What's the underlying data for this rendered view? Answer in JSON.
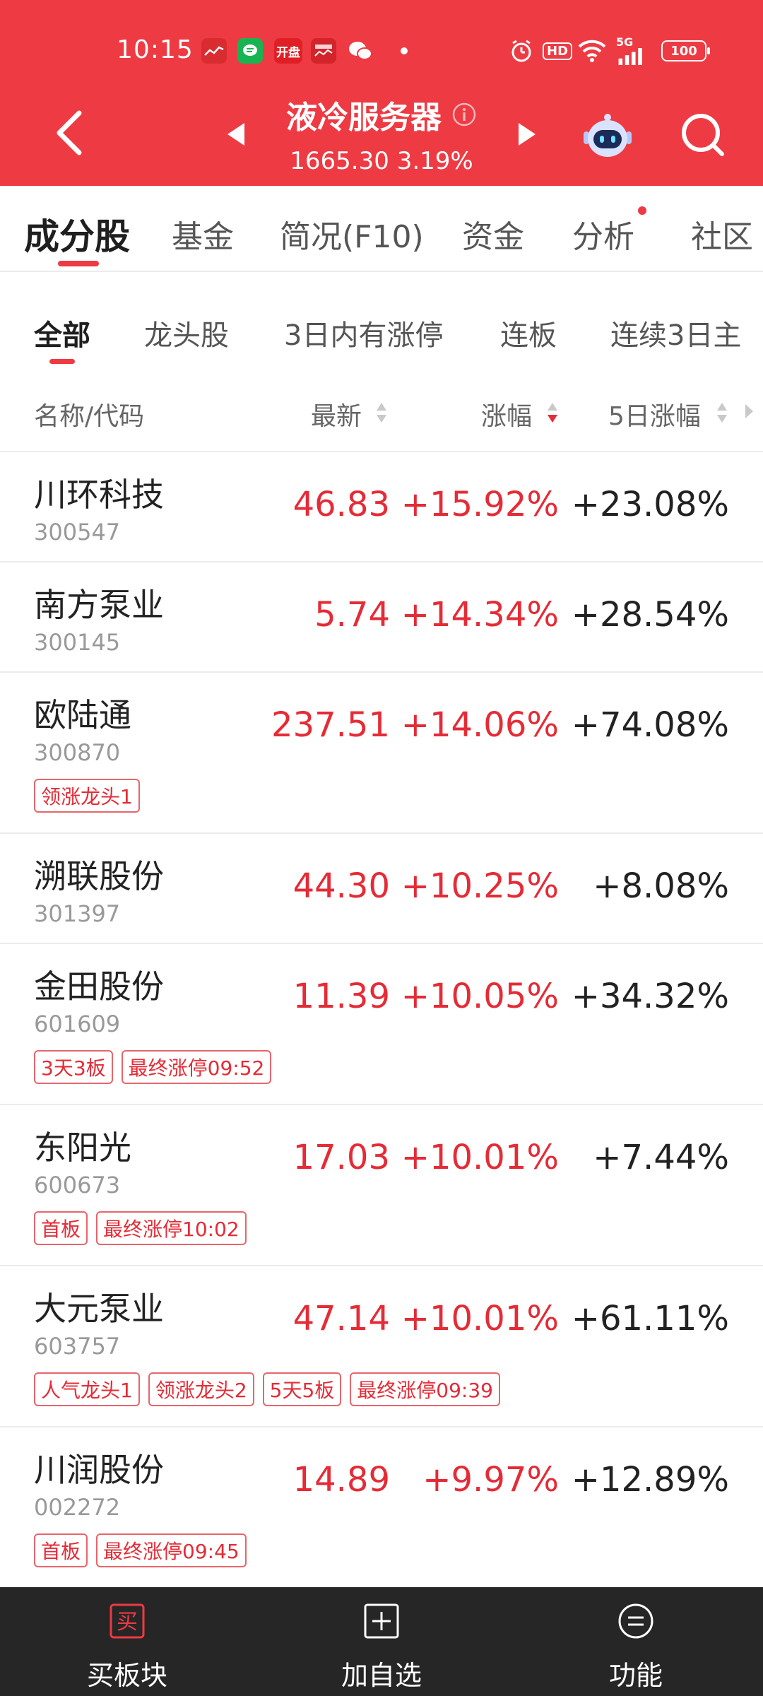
{
  "status_bar": {
    "time": "10:15",
    "notif_open": "开盘",
    "network": "5G",
    "hd": "HD",
    "battery": "100"
  },
  "header": {
    "title": "液冷服务器",
    "index_value": "1665.30",
    "index_change": "3.19%",
    "accent_color": "#ee3a43"
  },
  "main_tabs": [
    {
      "label": "成分股",
      "active": true
    },
    {
      "label": "基金"
    },
    {
      "label": "简况(F10)"
    },
    {
      "label": "资金"
    },
    {
      "label": "分析",
      "badge": "red-dot"
    },
    {
      "label": "社区"
    }
  ],
  "sub_tabs": [
    {
      "label": "全部",
      "active": true
    },
    {
      "label": "龙头股"
    },
    {
      "label": "3日内有涨停"
    },
    {
      "label": "连板"
    },
    {
      "label": "连续3日主"
    }
  ],
  "columns": {
    "name": "名称/代码",
    "latest": "最新",
    "change": "涨幅",
    "change5": "5日涨幅",
    "sorted_by": "涨幅 descending"
  },
  "stocks": [
    {
      "name": "川环科技",
      "code": "300547",
      "latest": "46.83",
      "change": "+15.92%",
      "change5": "+23.08%",
      "tags": []
    },
    {
      "name": "南方泵业",
      "code": "300145",
      "latest": "5.74",
      "change": "+14.34%",
      "change5": "+28.54%",
      "tags": []
    },
    {
      "name": "欧陆通",
      "code": "300870",
      "latest": "237.51",
      "change": "+14.06%",
      "change5": "+74.08%",
      "tags": [
        "领涨龙头1"
      ]
    },
    {
      "name": "溯联股份",
      "code": "301397",
      "latest": "44.30",
      "change": "+10.25%",
      "change5": "+8.08%",
      "tags": []
    },
    {
      "name": "金田股份",
      "code": "601609",
      "latest": "11.39",
      "change": "+10.05%",
      "change5": "+34.32%",
      "tags": [
        "3天3板",
        "最终涨停09:52"
      ]
    },
    {
      "name": "东阳光",
      "code": "600673",
      "latest": "17.03",
      "change": "+10.01%",
      "change5": "+7.44%",
      "tags": [
        "首板",
        "最终涨停10:02"
      ]
    },
    {
      "name": "大元泵业",
      "code": "603757",
      "latest": "47.14",
      "change": "+10.01%",
      "change5": "+61.11%",
      "tags": [
        "人气龙头1",
        "领涨龙头2",
        "5天5板",
        "最终涨停09:39"
      ]
    },
    {
      "name": "川润股份",
      "code": "002272",
      "latest": "14.89",
      "change": "+9.97%",
      "change5": "+12.89%",
      "tags": [
        "首板",
        "最终涨停09:45"
      ]
    }
  ],
  "bottom_bar": [
    {
      "label": "买板块",
      "icon": "buy-icon",
      "icon_text": "买"
    },
    {
      "label": "加自选",
      "icon": "plus-box-icon"
    },
    {
      "label": "功能",
      "icon": "menu-circle-icon"
    }
  ],
  "colors": {
    "up": "#e52b36",
    "bottom_bar": "#262626"
  }
}
